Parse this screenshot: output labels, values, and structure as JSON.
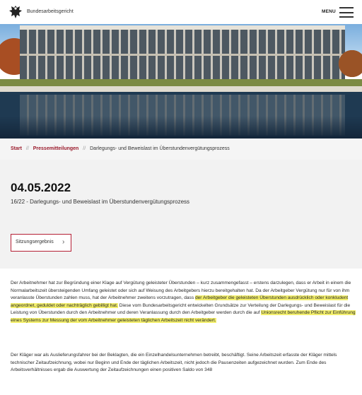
{
  "header": {
    "site_name": "Bundesarbeitsgericht",
    "menu_label": "MENU",
    "logo_icon": "federal-eagle-icon",
    "menu_icon": "hamburger-menu-icon"
  },
  "breadcrumb": {
    "items": [
      "Start",
      "Pressemitteilungen",
      "Darlegungs- und Beweislast im Überstundenvergütungsprozess"
    ],
    "separator": "//"
  },
  "press": {
    "date": "04.05.2022",
    "subtitle": "16/22 - Darlegungs- und Beweislast im Überstundenvergütungsprozess",
    "button_label": "Sitzungsergebnis",
    "button_icon": "chevron-right-icon"
  },
  "body": {
    "p1_a": "Der Arbeitnehmer hat zur Begründung einer Klage auf Vergütung geleisteter Überstunden – kurz zusammengefasst – erstens darzulegen, dass er Arbeit in einem die Normalarbeitszeit übersteigenden Umfang geleistet oder sich auf Weisung des Arbeitgebers hierzu bereitgehalten hat. Da der Arbeitgeber Vergütung nur für von ihm veranlasste Überstunden zahlen muss, hat der Arbeitnehmer zweitens vorzutragen, dass ",
    "p1_hl1": "der Arbeitgeber die geleisteten Überstunden ausdrücklich oder konkludent angeordnet, geduldet oder nachträglich gebilligt hat.",
    "p1_b": " Diese vom Bundesarbeitsgericht entwickelten Grundsätze zur Verteilung der Darlegungs- und Beweislast für die Leistung von Überstunden durch den Arbeitnehmer und deren Veranlassung durch den Arbeitgeber werden durch die auf ",
    "p1_hl2": "Unionsrecht beruhende Pflicht zur Einführung eines Systems zur Messung der vom Arbeitnehmer geleisteten täglichen Arbeitszeit nicht verändert.",
    "p2": "Der Kläger war als Auslieferungsfahrer bei der Beklagten, die ein Einzelhandelsunternehmen betreibt, beschäftigt. Seine Arbeitszeit erfasste der Kläger mittels technischer Zeitaufzeichnung, wobei nur Beginn und Ende der täglichen Arbeitszeit, nicht jedoch die Pausenzeiten aufgezeichnet wurden. Zum Ende des Arbeitsverhältnisses ergab die Auswertung der Zeitaufzeichnungen einen positiven Saldo von 348"
  },
  "colors": {
    "accent": "#9a1a2b",
    "button_border": "#b52035",
    "highlight": "#f3ef6c",
    "press_bg": "#f2f2f2"
  }
}
